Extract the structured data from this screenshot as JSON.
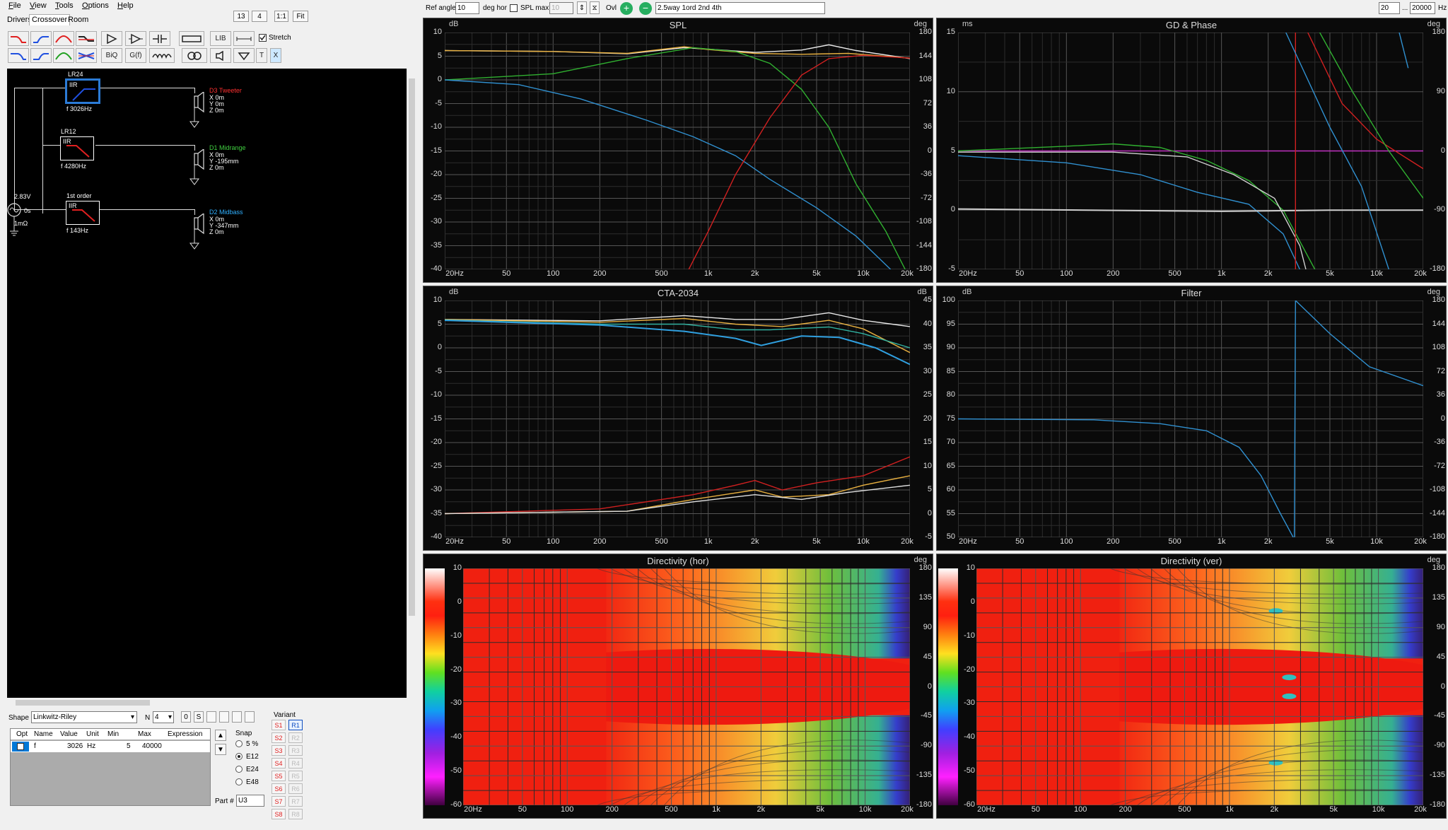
{
  "menu": [
    "File",
    "View",
    "Tools",
    "Options",
    "Help"
  ],
  "left_tabs": [
    "Drivers",
    "Crossover",
    "Room"
  ],
  "zoom": {
    "val1": "13",
    "val2": "4",
    "one_to_one": "1:1",
    "fit": "Fit"
  },
  "toolbar": {
    "lib": "LIB",
    "biq": "BiQ",
    "gf": "G(f)",
    "t": "T",
    "x": "X",
    "stretch": "Stretch"
  },
  "top_controls": {
    "ref_angle_label": "Ref angle",
    "ref_angle_value": "10",
    "deg_hor": "deg hor",
    "spl_max_label": "SPL max",
    "spl_max_value": "10",
    "ovl": "Ovl",
    "preset": "2.5way 1ord 2nd 4th",
    "freq_min": "20",
    "ellipsis": "...",
    "freq_max": "20000",
    "hz": "Hz"
  },
  "schematic": {
    "source": {
      "voltage": "2.83V",
      "delay": "0s",
      "impedance": "1mΩ"
    },
    "filters": [
      {
        "name": "LR24",
        "type": "IIR",
        "freq": "f  3026Hz"
      },
      {
        "name": "LR12",
        "type": "IIR",
        "freq": "f  4280Hz"
      },
      {
        "name": "1st order",
        "type": "IIR",
        "freq": "f  143Hz"
      }
    ],
    "drivers": [
      {
        "name": "D3 Tweeter",
        "x": "X  0m",
        "y": "Y  0m",
        "z": "Z  0m",
        "color": "#ff3030"
      },
      {
        "name": "D1 Midrange",
        "x": "X  0m",
        "y": "Y  -195mm",
        "z": "Z  0m",
        "color": "#40d040"
      },
      {
        "name": "D2 Midbass",
        "x": "X  0m",
        "y": "Y  -347mm",
        "z": "Z  0m",
        "color": "#30b0ff"
      }
    ]
  },
  "params": {
    "shape_label": "Shape",
    "shape_value": "Linkwitz-Riley",
    "n_label": "N",
    "n_value": "4",
    "btn_0": "0",
    "btn_s": "S",
    "headers": [
      "Opt",
      "Name",
      "Value",
      "Unit",
      "Min",
      "Max",
      "Expression"
    ],
    "row": {
      "name": "f",
      "value": "3026",
      "unit": "Hz",
      "min": "5",
      "max": "40000",
      "expression": ""
    },
    "snap_label": "Snap",
    "snap_options": [
      "5 %",
      "E12",
      "E24",
      "E48"
    ],
    "part_label": "Part #",
    "part_value": "U3",
    "variant_label": "Variant",
    "variants_s": [
      "S1",
      "S2",
      "S3",
      "S4",
      "S5",
      "S6",
      "S7",
      "S8"
    ],
    "variants_r": [
      "R1",
      "R2",
      "R3",
      "R4",
      "R5",
      "R6",
      "R7",
      "R8"
    ]
  },
  "graphs": {
    "x_ticks": [
      "20Hz",
      "50",
      "100",
      "200",
      "500",
      "1k",
      "2k",
      "5k",
      "10k",
      "20k"
    ],
    "spl": {
      "title": "SPL",
      "unit_l": "dB",
      "unit_r": "deg",
      "y_left": [
        "10",
        "5",
        "0",
        "-5",
        "-10",
        "-15",
        "-20",
        "-25",
        "-30",
        "-35",
        "-40"
      ],
      "y_right": [
        "180",
        "144",
        "108",
        "72",
        "36",
        "0",
        "-36",
        "-72",
        "-108",
        "-144",
        "-180"
      ]
    },
    "gd": {
      "title": "GD & Phase",
      "unit_l": "ms",
      "unit_r": "deg",
      "y_left": [
        "15",
        "10",
        "5",
        "0",
        "-5"
      ],
      "y_right": [
        "180",
        "90",
        "0",
        "-90",
        "-180"
      ]
    },
    "cta": {
      "title": "CTA-2034",
      "unit_l": "dB",
      "unit_r": "dB",
      "y_left": [
        "10",
        "5",
        "0",
        "-5",
        "-10",
        "-15",
        "-20",
        "-25",
        "-30",
        "-35",
        "-40"
      ],
      "y_right": [
        "45",
        "40",
        "35",
        "30",
        "25",
        "20",
        "15",
        "10",
        "5",
        "0",
        "-5"
      ]
    },
    "filter": {
      "title": "Filter",
      "unit_l": "dB",
      "unit_r": "deg",
      "y_left": [
        "100",
        "95",
        "90",
        "85",
        "80",
        "75",
        "70",
        "65",
        "60",
        "55",
        "50"
      ],
      "y_right": [
        "180",
        "144",
        "108",
        "72",
        "36",
        "0",
        "-36",
        "-72",
        "-108",
        "-144",
        "-180"
      ]
    },
    "dir_h": {
      "title": "Directivity (hor)",
      "unit_r": "deg",
      "scale": [
        "10",
        "0",
        "-10",
        "-20",
        "-30",
        "-40",
        "-50",
        "-60"
      ],
      "y_right": [
        "180",
        "135",
        "90",
        "45",
        "0",
        "-45",
        "-90",
        "-135",
        "-180"
      ]
    },
    "dir_v": {
      "title": "Directivity (ver)",
      "unit_r": "deg",
      "scale": [
        "10",
        "0",
        "-10",
        "-20",
        "-30",
        "-40",
        "-50",
        "-60"
      ],
      "y_right": [
        "180",
        "135",
        "90",
        "45",
        "0",
        "-45",
        "-90",
        "-135",
        "-180"
      ]
    }
  }
}
